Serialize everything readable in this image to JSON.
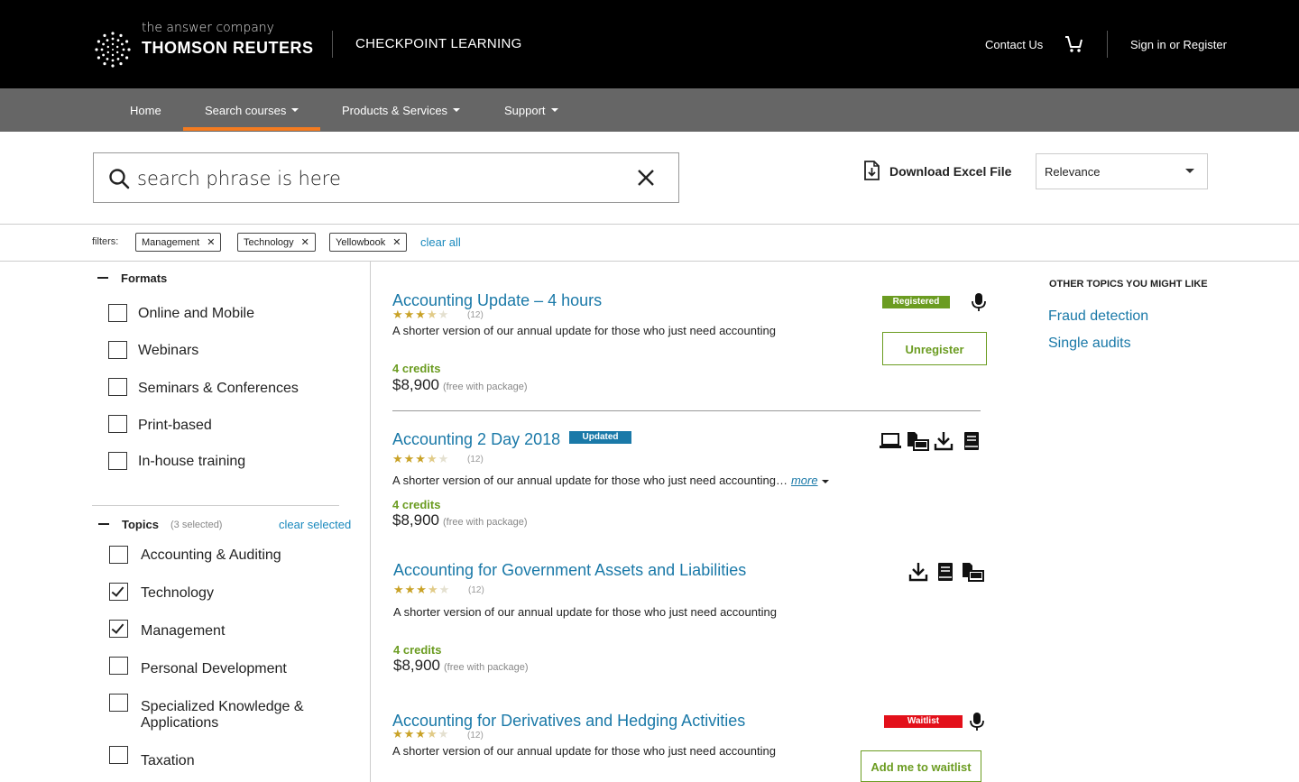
{
  "header": {
    "tagline": "the answer company",
    "brand": "THOMSON REUTERS",
    "product": "CHECKPOINT LEARNING",
    "contact": "Contact Us",
    "signin": "Sign in or Register",
    "cart_icon": "cart-icon"
  },
  "nav": {
    "items": [
      {
        "label": "Home",
        "dropdown": false
      },
      {
        "label": "Search courses",
        "dropdown": true,
        "active": true
      },
      {
        "label": "Products & Services",
        "dropdown": true
      },
      {
        "label": "Support",
        "dropdown": true
      }
    ],
    "accent_color": "#f47b20"
  },
  "search": {
    "value": "search phrase is here",
    "download_label": "Download Excel File",
    "sort_value": "Relevance"
  },
  "filters": {
    "label": "filters:",
    "chips": [
      "Management",
      "Technology",
      "Yellowbook"
    ],
    "clear_all": "clear all"
  },
  "sidebar": {
    "formats": {
      "title": "Formats",
      "options": [
        {
          "label": "Online and Mobile",
          "checked": false
        },
        {
          "label": "Webinars",
          "checked": false
        },
        {
          "label": "Seminars & Conferences",
          "checked": false
        },
        {
          "label": "Print-based",
          "checked": false
        },
        {
          "label": "In-house training",
          "checked": false
        }
      ]
    },
    "topics": {
      "title": "Topics",
      "count": "(3 selected)",
      "clear_selected": "clear selected",
      "options": [
        {
          "label": "Accounting & Auditing",
          "checked": false
        },
        {
          "label": "Technology",
          "checked": true
        },
        {
          "label": "Management",
          "checked": true
        },
        {
          "label": "Personal Development",
          "checked": false
        },
        {
          "label": "Specialized Knowledge & Applications",
          "checked": false
        },
        {
          "label": "Taxation",
          "checked": false
        }
      ]
    }
  },
  "results": [
    {
      "title": "Accounting Update – 4 hours",
      "rating": 3.5,
      "reviews": "(12)",
      "description": "A shorter version of our annual update for those who just need accounting",
      "credits": "4 credits",
      "price": "$8,900",
      "price_note": "(free with package)",
      "badge": "Registered",
      "badge_color": "#6b9c21",
      "action": "Unregister",
      "icons": [
        "microphone-icon"
      ]
    },
    {
      "title": "Accounting 2 Day 2018",
      "title_badge": "Updated",
      "title_badge_color": "#1a79a8",
      "rating": 3.5,
      "reviews": "(12)",
      "description": "A shorter version of our annual update for those who just need accounting…",
      "more": "more",
      "credits": "4 credits",
      "price": "$8,900",
      "price_note": "(free with package)",
      "icons": [
        "laptop-icon",
        "print-mobile-icon",
        "download-icon",
        "book-icon"
      ]
    },
    {
      "title": "Accounting for Government Assets and Liabilities",
      "rating": 3.5,
      "reviews": "(12)",
      "description": "A shorter version of our annual update for those who just need accounting",
      "credits": "4 credits",
      "price": "$8,900",
      "price_note": "(free with package)",
      "icons": [
        "download-icon",
        "book-icon",
        "print-mobile-icon"
      ]
    },
    {
      "title": "Accounting for Derivatives and Hedging Activities",
      "rating": 3.5,
      "reviews": "(12)",
      "description": "A shorter version of our annual update for those who just need accounting",
      "badge": "Waitlist",
      "badge_color": "#e3101a",
      "action": "Add me to waitlist",
      "icons": [
        "microphone-icon"
      ]
    }
  ],
  "other_topics": {
    "title": "OTHER TOPICS YOU MIGHT LIKE",
    "links": [
      "Fraud detection",
      "Single audits"
    ]
  }
}
